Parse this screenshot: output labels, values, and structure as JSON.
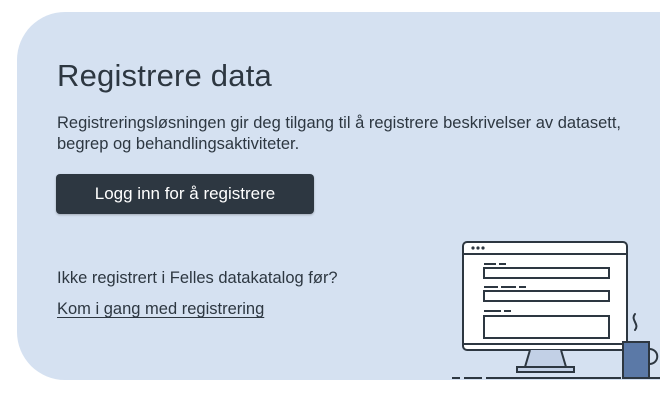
{
  "card": {
    "title": "Registrere data",
    "description": "Registreringsløsningen gir deg tilgang til å registrere beskrivelser av datasett, begrep og behandlingsaktiviteter.",
    "login_button": "Logg inn for å registrere",
    "question": "Ikke registrert i Felles datakatalog før?",
    "link": "Kom i gang med registrering"
  },
  "illustration": {
    "icon": "computer-with-form-and-coffee-mug-illustration"
  },
  "colors": {
    "panel_background": "#d5e1f1",
    "text": "#2d3741",
    "button_background": "#2d3741",
    "button_text": "#ffffff",
    "mug": "#5b79a7"
  }
}
